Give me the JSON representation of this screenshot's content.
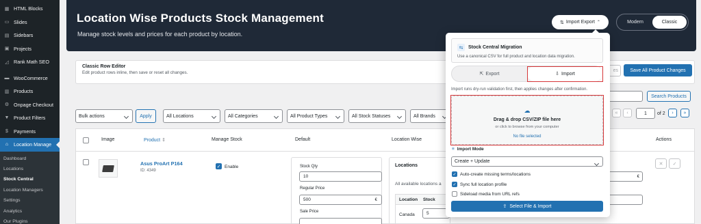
{
  "sidebar": {
    "items": [
      {
        "label": "HTML Blocks",
        "icon": "blocks-icon"
      },
      {
        "label": "Slides",
        "icon": "slides-icon"
      },
      {
        "label": "Sidebars",
        "icon": "sidebars-icon"
      },
      {
        "label": "Projects",
        "icon": "projects-icon"
      },
      {
        "label": "Rank Math SEO",
        "icon": "rank-math-icon"
      },
      {
        "label": "WooCommerce",
        "icon": "woocommerce-icon"
      },
      {
        "label": "Products",
        "icon": "products-icon"
      },
      {
        "label": "Onpage Checkout",
        "icon": "checkout-icon"
      },
      {
        "label": "Product Filters",
        "icon": "filter-icon"
      },
      {
        "label": "Payments",
        "icon": "payments-icon"
      },
      {
        "label": "Location Manage",
        "icon": "location-icon"
      }
    ],
    "submenu": [
      "Dashboard",
      "Locations",
      "Stock Central",
      "Location Managers",
      "Settings",
      "Analytics",
      "Our Plugins"
    ]
  },
  "header": {
    "title": "Location Wise Products Stock Management",
    "subtitle": "Manage stock levels and prices for each product by location.",
    "import_export_label": "Import Export",
    "modes": [
      "Modern",
      "Classic"
    ]
  },
  "editor": {
    "title": "Classic Row Editor",
    "subtitle": "Edit product rows inline, then save or reset all changes.",
    "reset_partial": "es",
    "save_all": "Save All Product Changes"
  },
  "search": {
    "button": "Search Products"
  },
  "filters": {
    "bulk_actions": "Bulk actions",
    "apply": "Apply",
    "locations": "All Locations",
    "categories": "All Categories",
    "product_types": "All Product Types",
    "stock_statuses": "All Stock Statuses",
    "brands": "All Brands"
  },
  "pagination": {
    "first": "«",
    "prev": "‹",
    "current": "1",
    "of_text": "of 2",
    "next": "›",
    "last": "»"
  },
  "table": {
    "headers": {
      "image": "Image",
      "product": "Product",
      "manage_stock": "Manage Stock",
      "default": "Default",
      "location_wise": "Location Wise",
      "actions": "Actions"
    },
    "row": {
      "name": "Asus ProArt P164",
      "id_text": "ID: 4349",
      "enable": "Enable",
      "stock_qty_label": "Stock Qty",
      "stock_qty": "10",
      "regular_price_label": "Regular Price",
      "regular_price": "500",
      "currency": "€",
      "sale_price_label": "Sale Price",
      "locations_title": "Locations",
      "locations_note": "All available locations a",
      "loc_col": "Location",
      "stock_col": "Stock",
      "loc_name": "Canada",
      "loc_stock": "5"
    }
  },
  "popup": {
    "mig_title": "Stock Central Migration",
    "mig_desc": "Use a canonical CSV for full product and location data migration.",
    "tab_export": "Export",
    "tab_import": "Import",
    "note": "Import runs dry-run validation first, then applies changes after confirmation.",
    "drop_title": "Drag & drop CSV/ZIP file here",
    "drop_sub": "or click to browse from your computer",
    "no_file": "No file selected",
    "mode_label": "Import Mode",
    "mode_value": "Create + Update",
    "opt1": "Auto-create missing terms/locations",
    "opt2": "Sync full location profile",
    "opt3": "Sideload media from URL refs",
    "opt1_checked": true,
    "opt2_checked": true,
    "opt3_checked": false,
    "submit": "Select File & Import"
  },
  "colors": {
    "accent": "#2271b1",
    "hero": "#1f2937",
    "sidebar": "#1d2327",
    "highlight": "#d63638"
  }
}
